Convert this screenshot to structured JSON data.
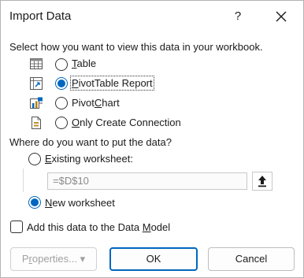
{
  "dialog": {
    "title": "Import Data",
    "help": "?"
  },
  "view_section": {
    "prompt": "Select how you want to view this data in your workbook.",
    "options": [
      {
        "pre": "",
        "ul": "T",
        "post": "able",
        "selected": false,
        "icon": "table-icon"
      },
      {
        "pre": "",
        "ul": "P",
        "post": "ivotTable Report",
        "selected": true,
        "icon": "pivottable-icon"
      },
      {
        "pre": "Pivot",
        "ul": "C",
        "post": "hart",
        "selected": false,
        "icon": "pivotchart-icon"
      },
      {
        "pre": "",
        "ul": "O",
        "post": "nly Create Connection",
        "selected": false,
        "icon": "connection-icon"
      }
    ]
  },
  "location_section": {
    "prompt": "Where do you want to put the data?",
    "existing": {
      "pre": "",
      "ul": "E",
      "post": "xisting worksheet:",
      "selected": false
    },
    "range_value": "=$D$10",
    "new": {
      "pre": "",
      "ul": "N",
      "post": "ew worksheet",
      "selected": true
    }
  },
  "data_model": {
    "pre": "Add this data to the Data ",
    "ul": "M",
    "post": "odel",
    "checked": false
  },
  "buttons": {
    "properties": {
      "pre": "P",
      "ul": "r",
      "post": "operties...",
      "arrow": "▾"
    },
    "ok": "OK",
    "cancel": "Cancel"
  },
  "colors": {
    "accent": "#0067c0",
    "border": "#b4b4b4"
  }
}
